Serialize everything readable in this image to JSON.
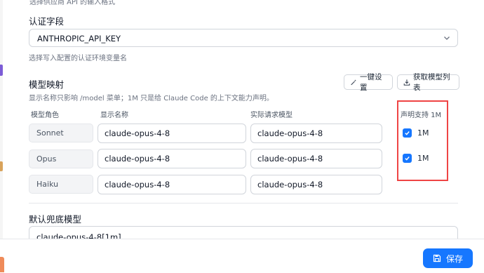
{
  "form": {
    "top_hint": "选择供应商 API 的输入格式",
    "auth": {
      "label": "认证字段",
      "value": "ANTHROPIC_API_KEY",
      "hint": "选择写入配置的认证环境变量名"
    },
    "mapping": {
      "title": "模型映射",
      "hint": "显示名称只影响 /model 菜单；1M 只是给 Claude Code 的上下文能力声明。",
      "btn_oneclick": "一键设置",
      "btn_fetch": "获取模型列表",
      "col_role": "模型角色",
      "col_display": "显示名称",
      "col_actual": "实际请求模型",
      "col_support": "声明支持 1M",
      "rows": [
        {
          "role": "Sonnet",
          "display": "claude-opus-4-8",
          "actual": "claude-opus-4-8",
          "checked": true,
          "check_label": "1M"
        },
        {
          "role": "Opus",
          "display": "claude-opus-4-8",
          "actual": "claude-opus-4-8",
          "checked": true,
          "check_label": "1M"
        },
        {
          "role": "Haiku",
          "display": "claude-opus-4-8",
          "actual": "claude-opus-4-8",
          "checked": false,
          "check_label": ""
        }
      ]
    },
    "fallback": {
      "label": "默认兜底模型",
      "value": "claude-opus-4-8[1m]"
    }
  },
  "footer": {
    "save_label": "保存"
  },
  "colors": {
    "accent": "#1677ff",
    "highlight": "#ef4444"
  }
}
